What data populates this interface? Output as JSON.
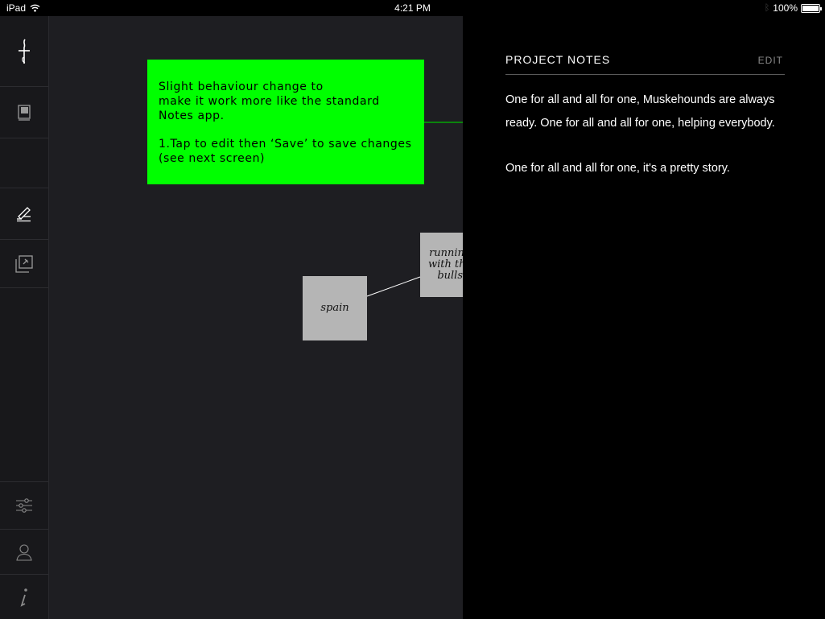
{
  "status_bar": {
    "device": "iPad",
    "time": "4:21 PM",
    "battery": "100%",
    "battery_level": 1.0
  },
  "sidebar": {
    "logo_icon": "dagger-logo-icon",
    "items": [
      {
        "name": "notebook-icon"
      },
      {
        "name": "empty-slot"
      },
      {
        "name": "pen-notes-icon"
      },
      {
        "name": "pinned-layers-icon"
      }
    ],
    "bottom_items": [
      {
        "name": "sliders-icon"
      },
      {
        "name": "user-icon"
      },
      {
        "name": "info-icon"
      }
    ]
  },
  "canvas": {
    "annotation": {
      "color": "#00ff00",
      "paragraph1": "Slight behaviour change to\nmake it work more like the standard\nNotes app.",
      "paragraph2": "1.Tap to edit then ‘Save’ to save changes\n(see next screen)"
    },
    "nodes": [
      {
        "label": "spain"
      },
      {
        "label": "running\nwith the\nbulls"
      }
    ]
  },
  "project_notes": {
    "title": "PROJECT NOTES",
    "edit_label": "EDIT",
    "paragraphs": [
      "One for all and all for one, Muskehounds are always ready. One for all and all for one, helping everybody.",
      "One for all and all for one, it's a pretty story."
    ]
  }
}
